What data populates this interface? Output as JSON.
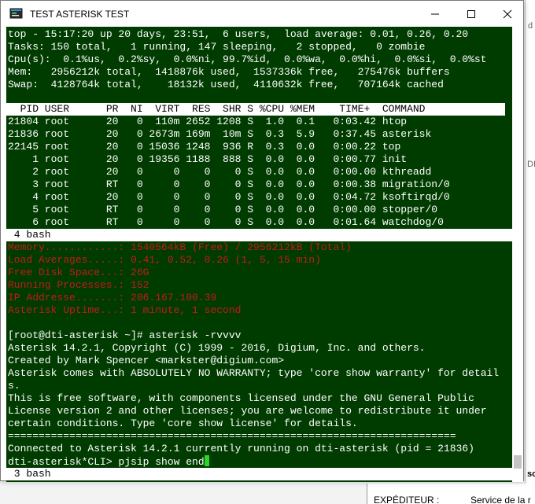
{
  "window": {
    "title": "TEST ASTERISK TEST",
    "minimize_glyph": "—",
    "maximize_glyph": "☐",
    "close_glyph": "✕",
    "icon": "terminal-app-icon"
  },
  "background_window": {
    "letter_1": "D",
    "letter_2": "D",
    "letter_3": "D",
    "right_text_1": "d",
    "right_text_2": "DI",
    "right_text_3": "sc",
    "sender_label": "EXPÉDITEUR :",
    "sender_value": "Service de la r"
  },
  "top_header": {
    "line1": "top - 15:17:20 up 20 days, 23:51,  6 users,  load average: 0.01, 0.26, 0.20",
    "line2": "Tasks: 150 total,   1 running, 147 sleeping,   2 stopped,   0 zombie",
    "line3": "Cpu(s):  0.1%us,  0.2%sy,  0.0%ni, 99.7%id,  0.0%wa,  0.0%hi,  0.0%si,  0.0%st",
    "line4": "Mem:   2956212k total,  1418876k used,  1537336k free,   275476k buffers",
    "line5": "Swap:  4128764k total,    18132k used,  4110632k free,   707164k cached"
  },
  "process_table": {
    "header": "  PID USER      PR  NI  VIRT  RES  SHR S %CPU %MEM    TIME+  COMMAND",
    "rows": [
      "21804 root      20   0  110m 2652 1208 S  1.0  0.1   0:03.42 htop",
      "21836 root      20   0 2673m 169m  10m S  0.3  5.9   0:37.45 asterisk",
      "22145 root      20   0 15036 1248  936 R  0.3  0.0   0:00.22 top",
      "    1 root      20   0 19356 1188  888 S  0.0  0.0   0:00.77 init",
      "    2 root      20   0     0    0    0 S  0.0  0.0   0:00.00 kthreadd",
      "    3 root      RT   0     0    0    0 S  0.0  0.0   0:00.38 migration/0",
      "    4 root      20   0     0    0    0 S  0.0  0.0   0:04.72 ksoftirqd/0",
      "    5 root      RT   0     0    0    0 S  0.0  0.0   0:00.00 stopper/0",
      "    6 root      RT   0     0    0    0 S  0.0  0.0   0:01.64 watchdog/0"
    ]
  },
  "tab_bar_1": " 4 bash",
  "status_info": {
    "memory": "Memory............: 1540564kB (Free) / 2956212kB (Total)",
    "load": "Load Averages.....: 0.41, 0.52, 0.26 (1, 5, 15 min)",
    "disk": "Free Disk Space...: 26G",
    "processes": "Running Processes.: 152",
    "ip": "IP Addresse.......: 206.167.100.39",
    "uptime": "Asterisk Uptime...: 1 minute, 1 second"
  },
  "console": {
    "prompt_cmd": "[root@dti-asterisk ~]# asterisk -rvvvv",
    "version": "Asterisk 14.2.1, Copyright (C) 1999 - 2016, Digium, Inc. and others.",
    "created_by": "Created by Mark Spencer <markster@digium.com>",
    "warranty_1": "Asterisk comes with ABSOLUTELY NO WARRANTY; type 'core show warranty' for detail",
    "warranty_2": "s.",
    "license_1": "This is free software, with components licensed under the GNU General Public",
    "license_2": "License version 2 and other licenses; you are welcome to redistribute it under",
    "license_3": "certain conditions. Type 'core show license' for details.",
    "separator": "=========================================================================",
    "connected": "Connected to Asterisk 14.2.1 currently running on dti-asterisk (pid = 21836)",
    "cli_prompt": "dti-asterisk*CLI> pjsip show end"
  },
  "tab_bar_2": " 3 bash",
  "colors": {
    "terminal_bg": "#003c00",
    "terminal_fg": "#ffffff",
    "status_red": "#c31a1a",
    "cursor": "#2ad52a"
  }
}
